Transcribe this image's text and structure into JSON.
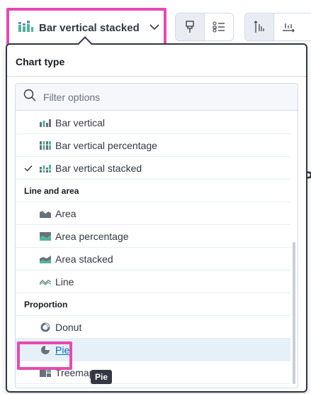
{
  "trigger": {
    "label": "Bar vertical stacked",
    "icon": "bar-vertical-stacked-icon"
  },
  "toolbar": {
    "group1": [
      "brush-icon",
      "list-legend-icon"
    ],
    "group2": [
      "axis-left-icon",
      "axis-bottom-icon"
    ]
  },
  "popover": {
    "title": "Chart type",
    "search_placeholder": "Filter options",
    "items": [
      {
        "label": "Bar vertical",
        "icon": "bar-vertical-icon",
        "checked": false
      },
      {
        "label": "Bar vertical percentage",
        "icon": "bar-vertical-percentage-icon",
        "checked": false
      },
      {
        "label": "Bar vertical stacked",
        "icon": "bar-vertical-stacked-icon",
        "checked": true
      }
    ],
    "groups": [
      {
        "label": "Line and area",
        "items": [
          {
            "label": "Area",
            "icon": "area-icon"
          },
          {
            "label": "Area percentage",
            "icon": "area-percentage-icon"
          },
          {
            "label": "Area stacked",
            "icon": "area-stacked-icon"
          },
          {
            "label": "Line",
            "icon": "line-icon"
          }
        ]
      },
      {
        "label": "Proportion",
        "items": [
          {
            "label": "Donut",
            "icon": "donut-icon"
          },
          {
            "label": "Pie",
            "icon": "pie-icon"
          },
          {
            "label": "Treemap",
            "icon": "treemap-icon"
          }
        ]
      }
    ]
  },
  "tooltip": "Pie",
  "colors": {
    "accent": "#006bb8",
    "highlight": "#e64ab0",
    "icon": "#54b399"
  }
}
